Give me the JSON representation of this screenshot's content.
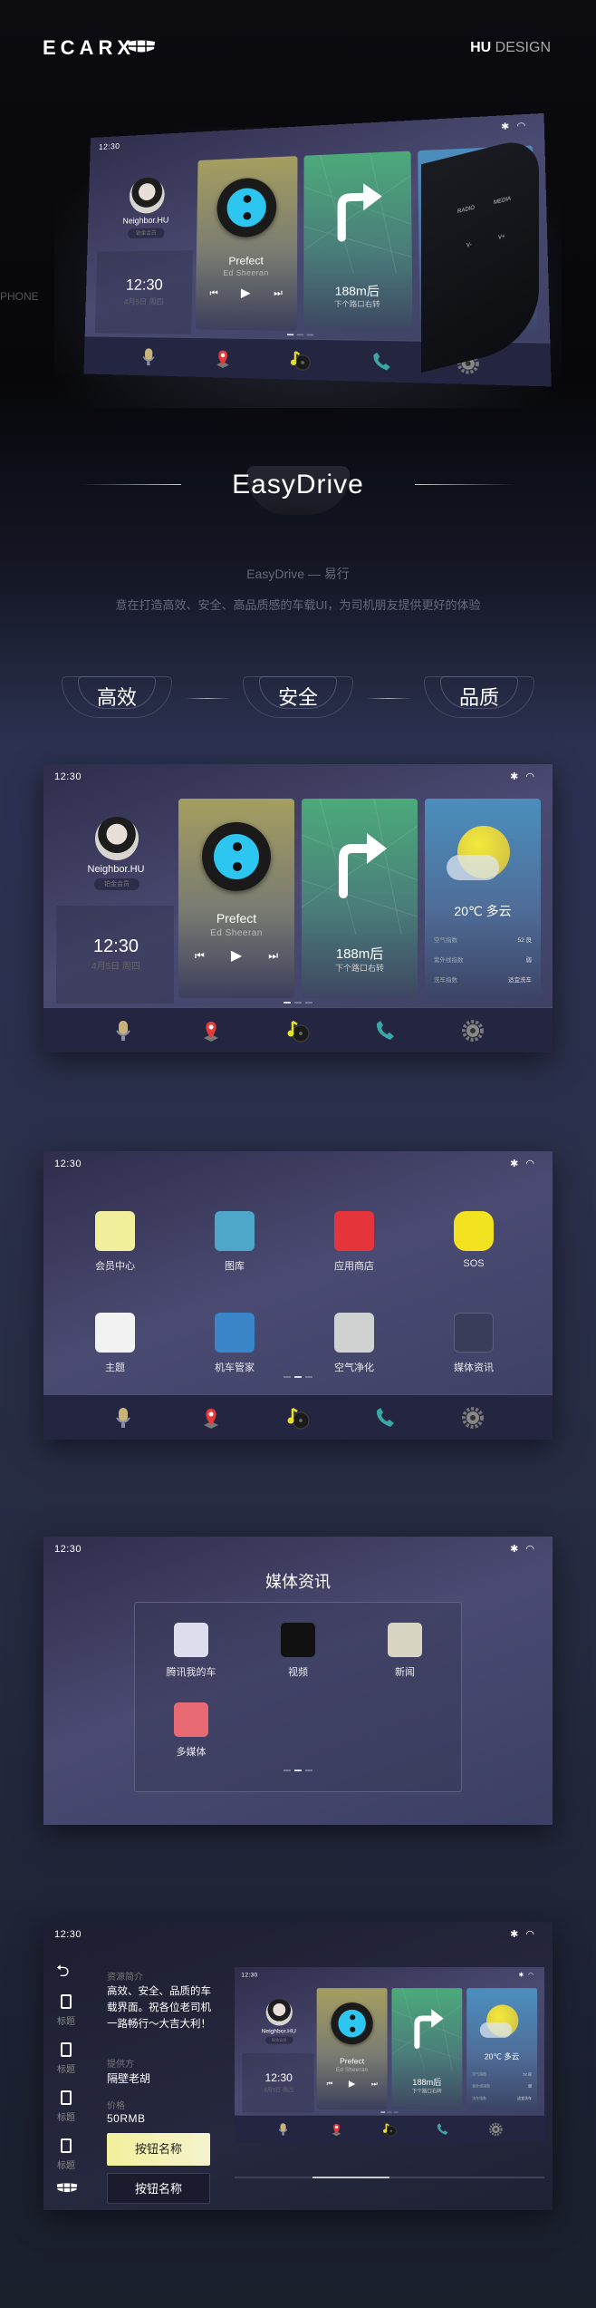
{
  "header": {
    "brand": "ECARX",
    "hu": "HU",
    "design": "DESIGN"
  },
  "hero": {
    "panel_radio": "RADIO",
    "panel_media": "MEDIA",
    "panel_vminus": "V-",
    "panel_vplus": "V+",
    "side_label": "PHONE"
  },
  "intro": {
    "title": "EasyDrive",
    "subtitle": "EasyDrive — 易行",
    "description": "意在打造高效、安全、高品质感的车载UI，为司机朋友提供更好的体验",
    "pillars": [
      "高效",
      "安全",
      "品质"
    ]
  },
  "status": {
    "time": "12:30",
    "bluetooth_icon": "bluetooth-icon",
    "wifi_icon": "wifi-icon"
  },
  "dashboard": {
    "user": {
      "name": "Neighbor.HU",
      "badge": "铂金会员"
    },
    "clock": {
      "time": "12:30",
      "date": "4月5日 周四"
    },
    "music": {
      "title": "Prefect",
      "artist": "Ed Sheeran",
      "prev": "⏮",
      "play": "▶",
      "next": "⏭"
    },
    "nav": {
      "distance": "188m后",
      "instruction": "下个路口右转"
    },
    "weather": {
      "temp": "20℃ 多云",
      "rows": [
        {
          "label": "空气指数",
          "value": "52 良"
        },
        {
          "label": "紫外线指数",
          "value": "弱"
        },
        {
          "label": "洗车指数",
          "value": "适宜洗车"
        }
      ]
    },
    "page": 1,
    "dock": [
      "microphone-icon",
      "map-pin-icon",
      "music-icon",
      "phone-icon",
      "gear-icon"
    ]
  },
  "apps": [
    {
      "label": "会员中心",
      "icon": "membership-card-icon",
      "color": "#f1ef9c"
    },
    {
      "label": "图库",
      "icon": "gallery-icon",
      "color": "#4ea7c8"
    },
    {
      "label": "应用商店",
      "icon": "shopping-bag-icon",
      "color": "#e6353a"
    },
    {
      "label": "SOS",
      "icon": "sos-icon",
      "color": "#f2e21f"
    },
    {
      "label": "主题",
      "icon": "shirt-icon",
      "color": "#f2f2f2"
    },
    {
      "label": "机车管家",
      "icon": "shield-icon",
      "color": "#3a86c8"
    },
    {
      "label": "空气净化",
      "icon": "air-purifier-icon",
      "color": "#cfd2d0"
    },
    {
      "label": "媒体资讯",
      "icon": "media-folder-icon",
      "color": "#3a3d5a"
    }
  ],
  "media": {
    "title": "媒体资讯",
    "apps": [
      {
        "label": "腾讯我的车",
        "icon": "tencent-car-icon",
        "color": "#dde"
      },
      {
        "label": "视频",
        "icon": "clapper-icon",
        "color": "#111"
      },
      {
        "label": "新闻",
        "icon": "newspaper-icon",
        "color": "#d8d4c4"
      },
      {
        "label": "多媒体",
        "icon": "radio-icon",
        "color": "#e86a72"
      }
    ]
  },
  "detail": {
    "side": [
      "标题",
      "标题",
      "标题",
      "标题"
    ],
    "intro_label": "资源简介",
    "intro_text": "高效、安全、品质的车载界面。祝各位老司机一路畅行～大吉大利！",
    "provider_label": "提供方",
    "provider": "隔壁老胡",
    "price_label": "价格",
    "price": "50RMB",
    "primary_button": "按钮名称",
    "secondary_button": "按钮名称",
    "scroll_position": 0.25
  }
}
